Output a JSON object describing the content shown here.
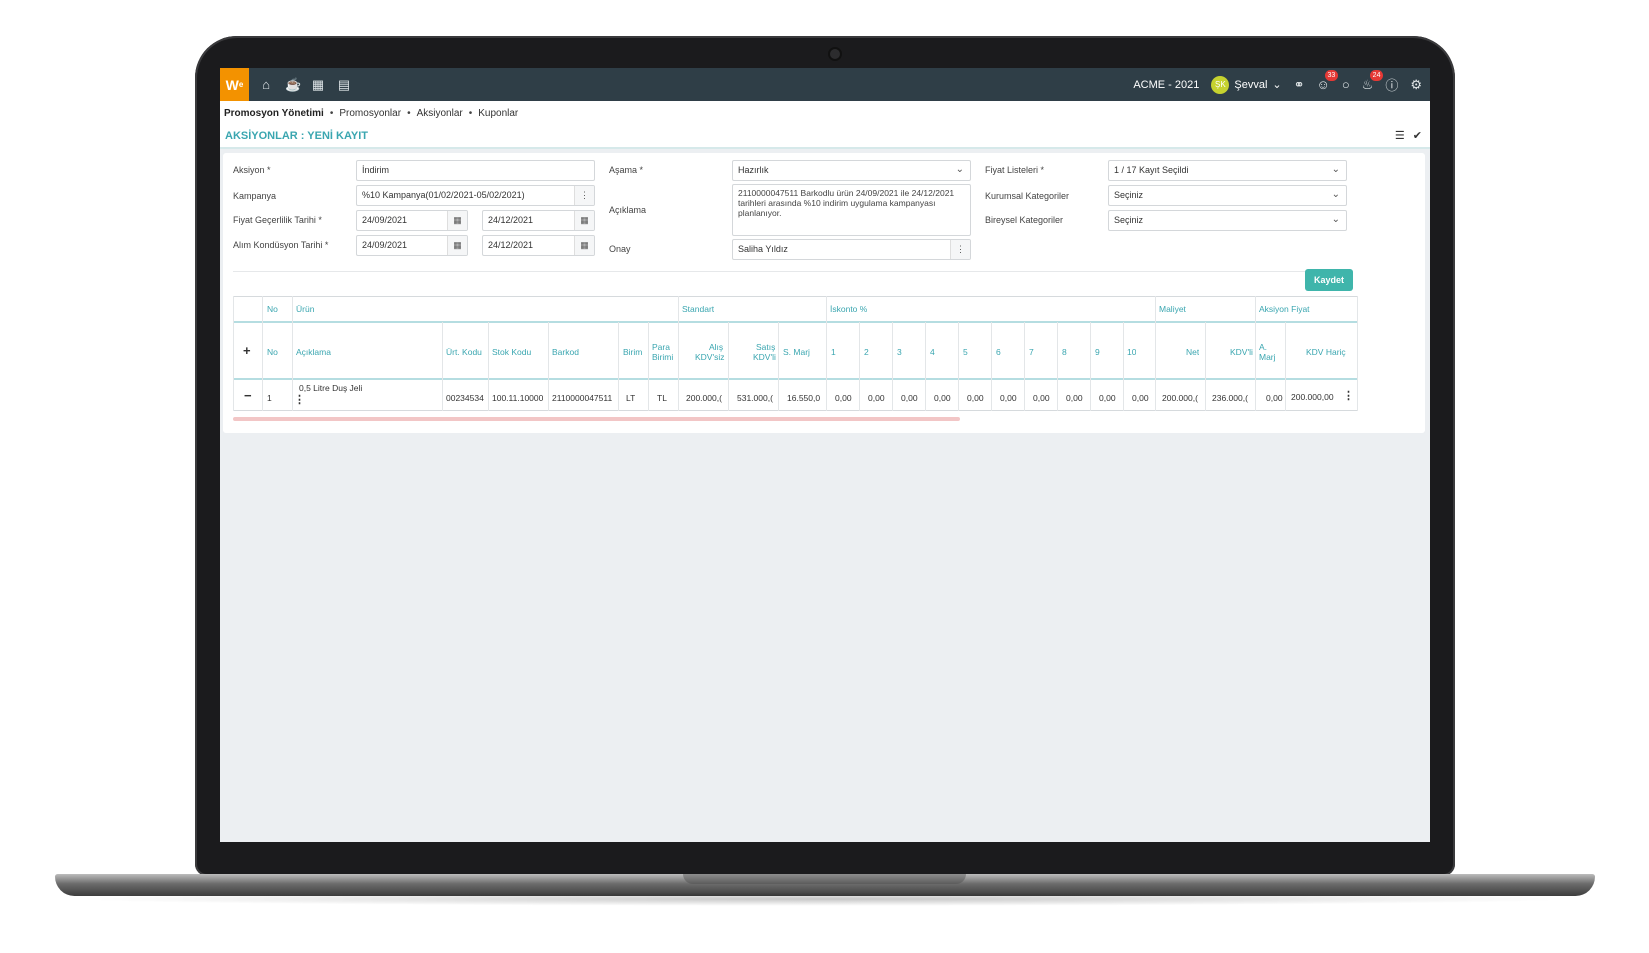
{
  "topbar": {
    "logo": "W",
    "logo_sup": "e",
    "company": "ACME - 2021",
    "user_initials": "ŞK",
    "user_name": "Şevval",
    "badge_support": "33",
    "badge_notifications": "24"
  },
  "breadcrumb": {
    "root": "Promosyon Yönetimi",
    "items": [
      "Promosyonlar",
      "Aksiyonlar",
      "Kuponlar"
    ]
  },
  "page": {
    "title": "AKSİYONLAR : YENİ KAYIT"
  },
  "form": {
    "aksiyon_label": "Aksiyon *",
    "aksiyon_value": "İndirim",
    "kampanya_label": "Kampanya",
    "kampanya_value": "%10 Kampanya(01/02/2021-05/02/2021)",
    "fiyat_label": "Fiyat Geçerlilik Tarihi *",
    "fiyat_start": "24/09/2021",
    "fiyat_end": "24/12/2021",
    "alim_label": "Alım Kondüsyon Tarihi *",
    "alim_start": "24/09/2021",
    "alim_end": "24/12/2021",
    "asama_label": "Aşama *",
    "asama_value": "Hazırlık",
    "aciklama_label": "Açıklama",
    "aciklama_value": "2110000047511 Barkodlu ürün 24/09/2021 ile 24/12/2021 tarihleri arasında %10 indirim uygulama kampanyası planlanıyor.",
    "onay_label": "Onay",
    "onay_value": "Saliha Yıldız",
    "fiyat_listeleri_label": "Fiyat Listeleri *",
    "fiyat_listeleri_value": "1 / 17 Kayıt Seçildi",
    "kurumsal_label": "Kurumsal Kategoriler",
    "kurumsal_value": "Seçiniz",
    "bireysel_label": "Bireysel Kategoriler",
    "bireysel_value": "Seçiniz",
    "save_label": "Kaydet"
  },
  "table": {
    "groups": {
      "no": "No",
      "urun": "Ürün",
      "standart": "Standart",
      "iskonto": "İskonto %",
      "maliyet": "Maliyet",
      "aksiyon": "Aksiyon Fiyat"
    },
    "headers": {
      "no": "No",
      "aciklama": "Açıklama",
      "urt_kodu": "Ürt. Kodu",
      "stok_kodu": "Stok Kodu",
      "barkod": "Barkod",
      "birim": "Birim",
      "para_1": "Para",
      "para_2": "Birimi",
      "alis_1": "Alış",
      "alis_2": "KDV'siz",
      "satis_1": "Satış",
      "satis_2": "KDV'li",
      "s_marj": "S. Marj",
      "iskonto": [
        "1",
        "2",
        "3",
        "4",
        "5",
        "6",
        "7",
        "8",
        "9",
        "10"
      ],
      "net": "Net",
      "kdvli": "KDV'li",
      "a_marj_1": "A.",
      "a_marj_2": "Marj",
      "kdv_haric": "KDV Hariç"
    },
    "row": {
      "no": "1",
      "aciklama": "0,5 Litre Duş Jeli",
      "urt_kodu": "00234534",
      "stok_kodu": "100.11.10000",
      "barkod": "2110000047511",
      "birim": "LT",
      "para": "TL",
      "alis": "200.000,(",
      "satis": "531.000,(",
      "s_marj": "16.550,0",
      "iskonto": [
        "0,00",
        "0,00",
        "0,00",
        "0,00",
        "0,00",
        "0,00",
        "0,00",
        "0,00",
        "0,00",
        "0,00"
      ],
      "net": "200.000,(",
      "kdvli": "236.000,(",
      "a_marj": "0,00",
      "kdv_haric": "200.000,00"
    }
  }
}
